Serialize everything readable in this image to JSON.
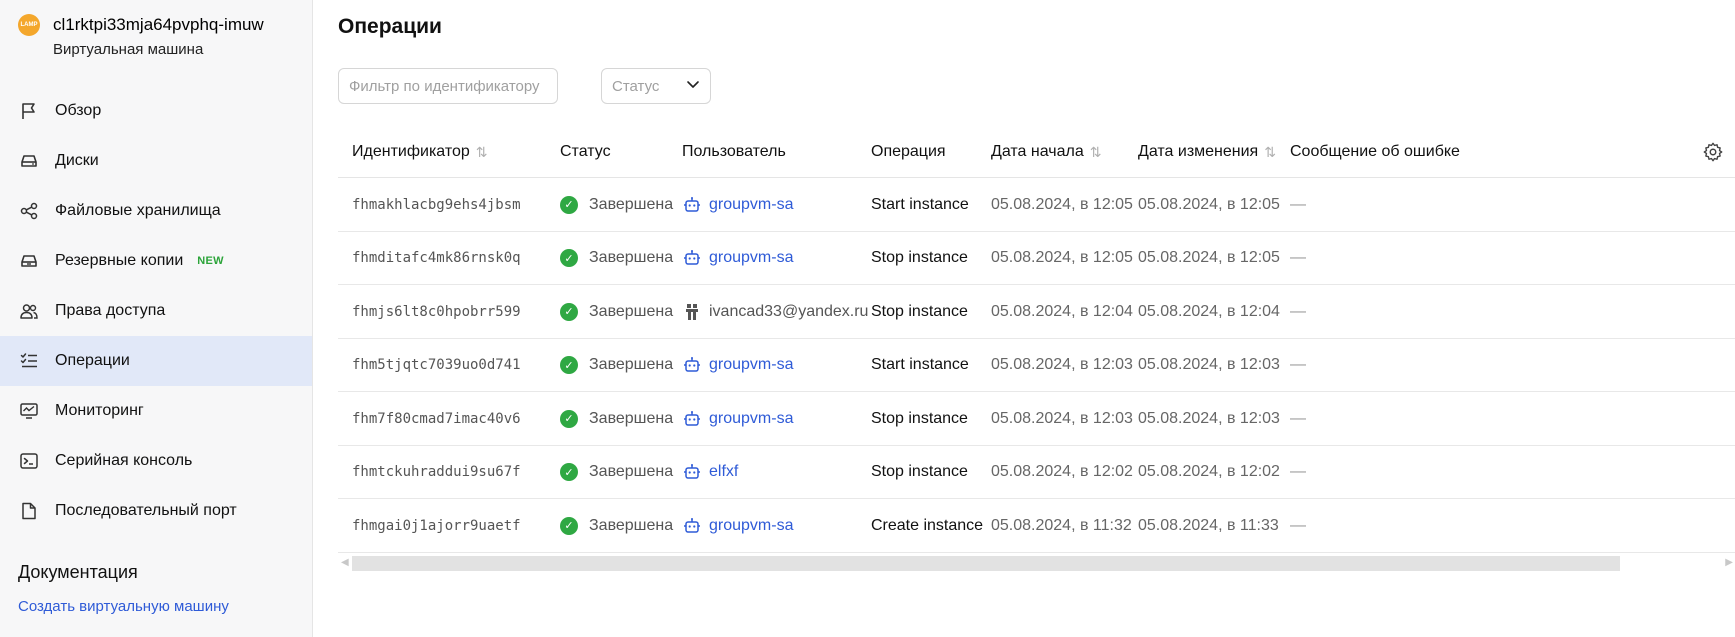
{
  "vm": {
    "logo_text": "LAMP",
    "name": "cl1rktpi33mja64pvphq-imuw",
    "type": "Виртуальная машина"
  },
  "nav": {
    "items": [
      {
        "label": "Обзор",
        "icon": "flag-icon"
      },
      {
        "label": "Диски",
        "icon": "disk-icon"
      },
      {
        "label": "Файловые хранилища",
        "icon": "share-icon"
      },
      {
        "label": "Резервные копии",
        "icon": "backup-icon",
        "badge": "NEW"
      },
      {
        "label": "Права доступа",
        "icon": "users-icon"
      },
      {
        "label": "Операции",
        "icon": "list-check-icon",
        "active": true
      },
      {
        "label": "Мониторинг",
        "icon": "monitor-icon"
      },
      {
        "label": "Серийная консоль",
        "icon": "terminal-icon"
      },
      {
        "label": "Последовательный порт",
        "icon": "file-icon"
      }
    ]
  },
  "docs": {
    "title": "Документация",
    "link": "Создать виртуальную машину"
  },
  "page": {
    "title": "Операции",
    "filter_placeholder": "Фильтр по идентификатору",
    "status_placeholder": "Статус"
  },
  "table": {
    "headers": {
      "id": "Идентификатор",
      "status": "Статус",
      "user": "Пользователь",
      "operation": "Операция",
      "start": "Дата начала",
      "modified": "Дата изменения",
      "error": "Сообщение об ошибке"
    },
    "rows": [
      {
        "id": "fhmakhlacbg9ehs4jbsm",
        "status": "Завершена",
        "user": "groupvm-sa",
        "user_kind": "service",
        "operation": "Start instance",
        "start": "05.08.2024, в 12:05",
        "modified": "05.08.2024, в 12:05",
        "error": "—"
      },
      {
        "id": "fhmditafc4mk86rnsk0q",
        "status": "Завершена",
        "user": "groupvm-sa",
        "user_kind": "service",
        "operation": "Stop instance",
        "start": "05.08.2024, в 12:05",
        "modified": "05.08.2024, в 12:05",
        "error": "—"
      },
      {
        "id": "fhmjs6lt8c0hpobrr599",
        "status": "Завершена",
        "user": "ivancad33@yandex.ru",
        "user_kind": "person",
        "operation": "Stop instance",
        "start": "05.08.2024, в 12:04",
        "modified": "05.08.2024, в 12:04",
        "error": "—"
      },
      {
        "id": "fhm5tjqtc7039uo0d741",
        "status": "Завершена",
        "user": "groupvm-sa",
        "user_kind": "service",
        "operation": "Start instance",
        "start": "05.08.2024, в 12:03",
        "modified": "05.08.2024, в 12:03",
        "error": "—"
      },
      {
        "id": "fhm7f80cmad7imac40v6",
        "status": "Завершена",
        "user": "groupvm-sa",
        "user_kind": "service",
        "operation": "Stop instance",
        "start": "05.08.2024, в 12:03",
        "modified": "05.08.2024, в 12:03",
        "error": "—"
      },
      {
        "id": "fhmtckuhraddui9su67f",
        "status": "Завершена",
        "user": "elfxf",
        "user_kind": "service",
        "operation": "Stop instance",
        "start": "05.08.2024, в 12:02",
        "modified": "05.08.2024, в 12:02",
        "error": "—"
      },
      {
        "id": "fhmgai0j1ajorr9uaetf",
        "status": "Завершена",
        "user": "groupvm-sa",
        "user_kind": "service",
        "operation": "Create instance",
        "start": "05.08.2024, в 11:32",
        "modified": "05.08.2024, в 11:33",
        "error": "—"
      }
    ]
  },
  "colors": {
    "accent": "#2f5bd7",
    "success": "#2fa843",
    "active_nav_bg": "#e1e8f8",
    "badge_new": "#2ca43a"
  }
}
